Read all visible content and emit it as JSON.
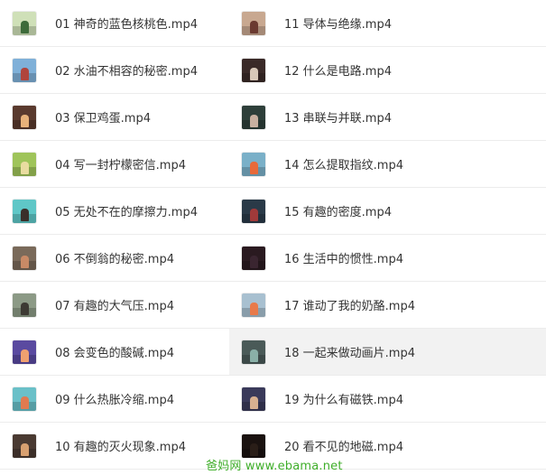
{
  "files_left": [
    {
      "label": "01 神奇的蓝色核桃色.mp4",
      "thumb_bg": "#cfe0b8",
      "thumb_fig": "#3d6b3a"
    },
    {
      "label": "02 水油不相容的秘密.mp4",
      "thumb_bg": "#7fb0d8",
      "thumb_fig": "#b0443c"
    },
    {
      "label": "03 保卫鸡蛋.mp4",
      "thumb_bg": "#5a3a2e",
      "thumb_fig": "#e8b27a"
    },
    {
      "label": "04 写一封柠檬密信.mp4",
      "thumb_bg": "#9fc45a",
      "thumb_fig": "#e9dca0"
    },
    {
      "label": "05 无处不在的摩擦力.mp4",
      "thumb_bg": "#5fc7c7",
      "thumb_fig": "#3a2f2a"
    },
    {
      "label": "06 不倒翁的秘密.mp4",
      "thumb_bg": "#7a6a5a",
      "thumb_fig": "#c98a66"
    },
    {
      "label": "07 有趣的大气压.mp4",
      "thumb_bg": "#8c9a86",
      "thumb_fig": "#3d3a34"
    },
    {
      "label": "08 会变色的酸碱.mp4",
      "thumb_bg": "#5a4aa0",
      "thumb_fig": "#f0a070"
    },
    {
      "label": "09 什么热胀冷缩.mp4",
      "thumb_bg": "#6ac0c8",
      "thumb_fig": "#e07a50"
    },
    {
      "label": "10 有趣的灭火现象.mp4",
      "thumb_bg": "#4a3a32",
      "thumb_fig": "#d8a070"
    }
  ],
  "files_right": [
    {
      "label": "11 导体与绝缘.mp4",
      "thumb_bg": "#c8a890",
      "thumb_fig": "#6a3a30"
    },
    {
      "label": "12 什么是电路.mp4",
      "thumb_bg": "#3a2a28",
      "thumb_fig": "#d8c8b8"
    },
    {
      "label": "13 串联与并联.mp4",
      "thumb_bg": "#2e3f3a",
      "thumb_fig": "#c8b0a0"
    },
    {
      "label": "14 怎么提取指纹.mp4",
      "thumb_bg": "#7ab0c8",
      "thumb_fig": "#e86a3a"
    },
    {
      "label": "15 有趣的密度.mp4",
      "thumb_bg": "#2a3a48",
      "thumb_fig": "#a03a3a"
    },
    {
      "label": "16 生活中的惯性.mp4",
      "thumb_bg": "#2a1a20",
      "thumb_fig": "#3a2530"
    },
    {
      "label": "17 谁动了我的奶酪.mp4",
      "thumb_bg": "#a8c0d0",
      "thumb_fig": "#e87a4a"
    },
    {
      "label": "18 一起来做动画片.mp4",
      "thumb_bg": "#4a5a58",
      "thumb_fig": "#8ab0a8"
    },
    {
      "label": "19 为什么有磁铁.mp4",
      "thumb_bg": "#3a3a5a",
      "thumb_fig": "#d8b090"
    },
    {
      "label": "20 看不见的地磁.mp4",
      "thumb_bg": "#1a1210",
      "thumb_fig": "#2a1e18"
    }
  ],
  "selected_index_right": 7,
  "watermark": "爸妈网 www.ebama.net",
  "colors": {
    "watermark": "#3fae2a",
    "row_selected": "#f2f2f2",
    "divider": "#ececec"
  }
}
